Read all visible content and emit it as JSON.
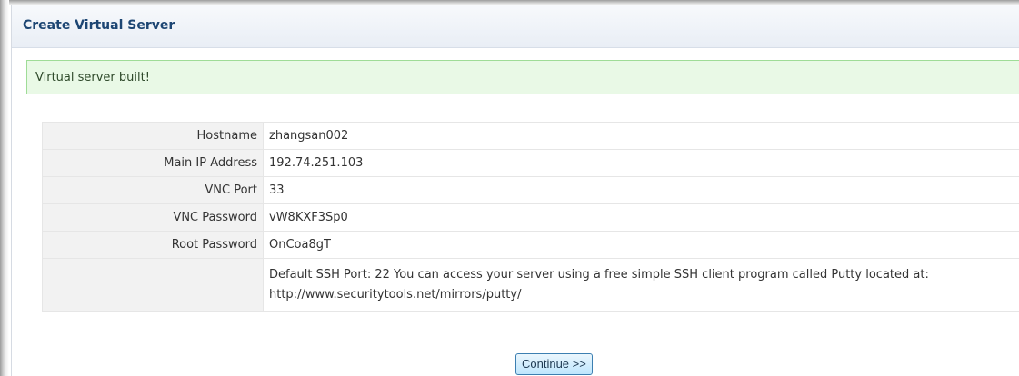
{
  "panel": {
    "title": "Create Virtual Server"
  },
  "alert": {
    "message": "Virtual server built!"
  },
  "details": {
    "rows": [
      {
        "label": "Hostname",
        "value": "zhangsan002"
      },
      {
        "label": "Main IP Address",
        "value": "192.74.251.103"
      },
      {
        "label": "VNC Port",
        "value": "33"
      },
      {
        "label": "VNC Password",
        "value": "vW8KXF3Sp0"
      },
      {
        "label": "Root Password",
        "value": "OnCoa8gT"
      },
      {
        "label": "",
        "value": "Default SSH Port: 22 You can access your server using a free simple SSH client program called Putty located at:",
        "value_line2": "http://www.securitytools.net/mirrors/putty/"
      }
    ]
  },
  "actions": {
    "continue_label": "Continue >>"
  },
  "colors": {
    "title": "#1d4673",
    "alert_bg": "#e9f9e6",
    "alert_border": "#9fdc97",
    "label_bg": "#f2f2f2",
    "button_border": "#3c7fb1"
  }
}
